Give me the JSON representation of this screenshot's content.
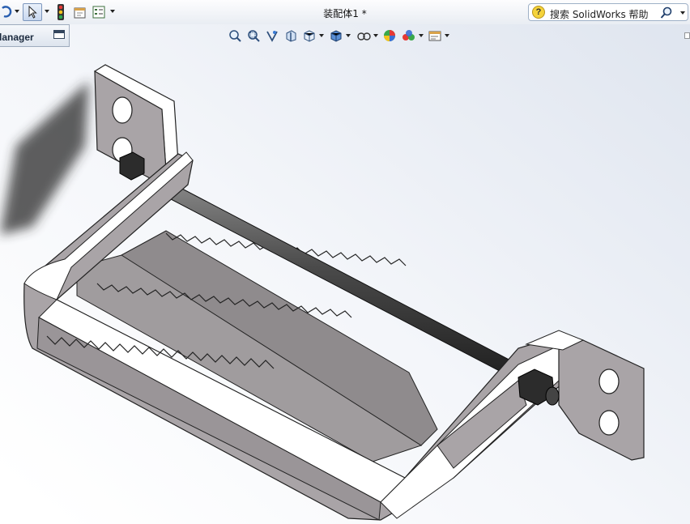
{
  "window": {
    "title": "装配体1 *"
  },
  "search": {
    "text": "搜索 SolidWorks 帮助"
  },
  "feature_manager": {
    "label": "lanager"
  },
  "colors": {
    "metal": "#a9a4a7",
    "metal_light": "#ffffff",
    "metal_dark": "#6f6a6d",
    "rod": "#4a4a4a",
    "plate": "#8e8a8c",
    "viewport_bg": "#ffffff"
  },
  "toolbar_icons": [
    "undo-icon",
    "select-arrow-icon",
    "traffic-light-icon",
    "file-properties-icon",
    "options-icon"
  ],
  "heads_up_icons": [
    "zoom-to-fit-icon",
    "zoom-area-icon",
    "previous-view-icon",
    "section-view-icon",
    "view-orientation-icon",
    "display-style-icon",
    "hide-show-icon",
    "appearance-icon",
    "scene-icon",
    "view-settings-icon"
  ]
}
